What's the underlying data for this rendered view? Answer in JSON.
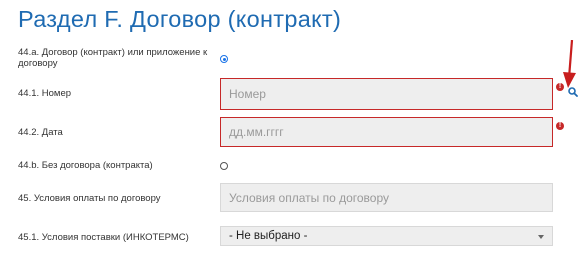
{
  "section": {
    "title": "Раздел F. Договор (контракт)"
  },
  "fields": {
    "contract_or_attachment": {
      "label": "44.а. Договор (контракт) или приложение к договору",
      "checked": true
    },
    "number": {
      "label": "44.1. Номер",
      "placeholder": "Номер",
      "value": ""
    },
    "date": {
      "label": "44.2. Дата",
      "placeholder": "дд.мм.гггг",
      "value": ""
    },
    "no_contract": {
      "label": "44.b. Без договора (контракта)",
      "checked": false
    },
    "payment_terms": {
      "label": "45. Условия оплаты по договору",
      "placeholder": "Условия оплаты по договору",
      "value": ""
    },
    "delivery_terms": {
      "label": "45.1. Условия поставки (ИНКОТЕРМС)",
      "selected": "- Не выбрано -"
    }
  },
  "icons": {
    "error": "error-icon",
    "search": "search-icon",
    "annotation": "red-arrow-annotation"
  },
  "colors": {
    "title": "#1f6bb2",
    "error": "#c62828",
    "radio_active": "#1a73e8",
    "field_bg": "#eeeeee",
    "annotation_arrow": "#c81e1e"
  }
}
